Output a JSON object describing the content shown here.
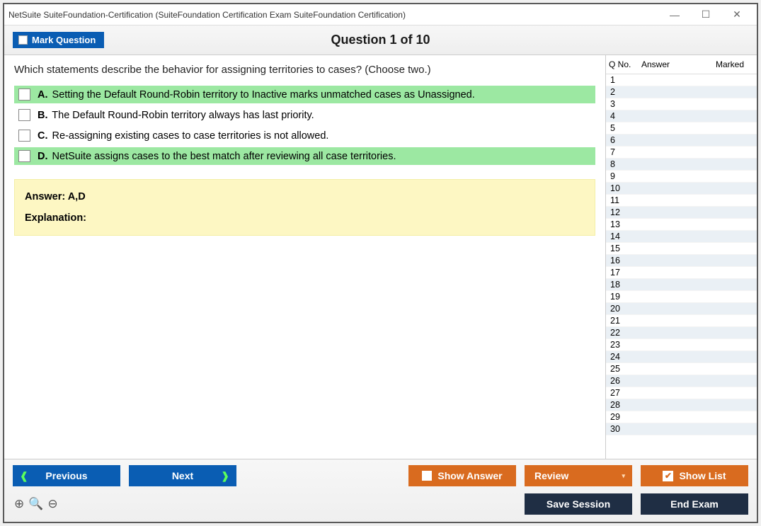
{
  "window": {
    "title": "NetSuite SuiteFoundation-Certification (SuiteFoundation Certification Exam SuiteFoundation Certification)"
  },
  "toolbar": {
    "mark_label": "Mark Question",
    "heading": "Question 1 of 10"
  },
  "question": {
    "text": "Which statements describe the behavior for assigning territories to cases? (Choose two.)",
    "options": [
      {
        "letter": "A.",
        "text": "Setting the Default Round-Robin territory to Inactive marks unmatched cases as Unassigned.",
        "correct": true
      },
      {
        "letter": "B.",
        "text": "The Default Round-Robin territory always has last priority.",
        "correct": false
      },
      {
        "letter": "C.",
        "text": "Re-assigning existing cases to case territories is not allowed.",
        "correct": false
      },
      {
        "letter": "D.",
        "text": "NetSuite assigns cases to the best match after reviewing all case territories.",
        "correct": true
      }
    ],
    "answer_label": "Answer: A,D",
    "explanation_label": "Explanation:"
  },
  "side": {
    "col_qno": "Q No.",
    "col_answer": "Answer",
    "col_marked": "Marked",
    "rows": [
      "1",
      "2",
      "3",
      "4",
      "5",
      "6",
      "7",
      "8",
      "9",
      "10",
      "11",
      "12",
      "13",
      "14",
      "15",
      "16",
      "17",
      "18",
      "19",
      "20",
      "21",
      "22",
      "23",
      "24",
      "25",
      "26",
      "27",
      "28",
      "29",
      "30"
    ]
  },
  "footer": {
    "previous": "Previous",
    "next": "Next",
    "show_answer": "Show Answer",
    "review": "Review",
    "show_list": "Show List",
    "save_session": "Save Session",
    "end_exam": "End Exam"
  }
}
